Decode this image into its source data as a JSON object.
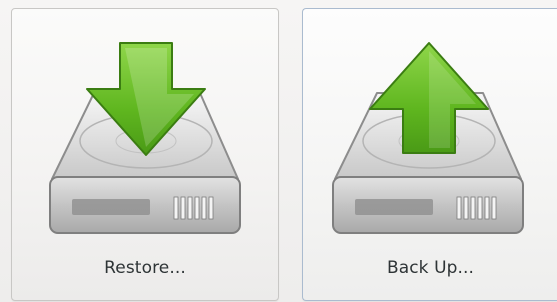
{
  "actions": {
    "restore": {
      "label": "Restore...",
      "icon": "drive-restore-icon",
      "arrow_direction": "down"
    },
    "backup": {
      "label": "Back Up...",
      "icon": "drive-backup-icon",
      "arrow_direction": "up"
    }
  },
  "colors": {
    "arrow_green": "#5fb61f",
    "arrow_outline": "#3b7d12",
    "drive_body": "#c9c9c9",
    "text": "#2e3436",
    "selected_border": "#aabbcf"
  }
}
